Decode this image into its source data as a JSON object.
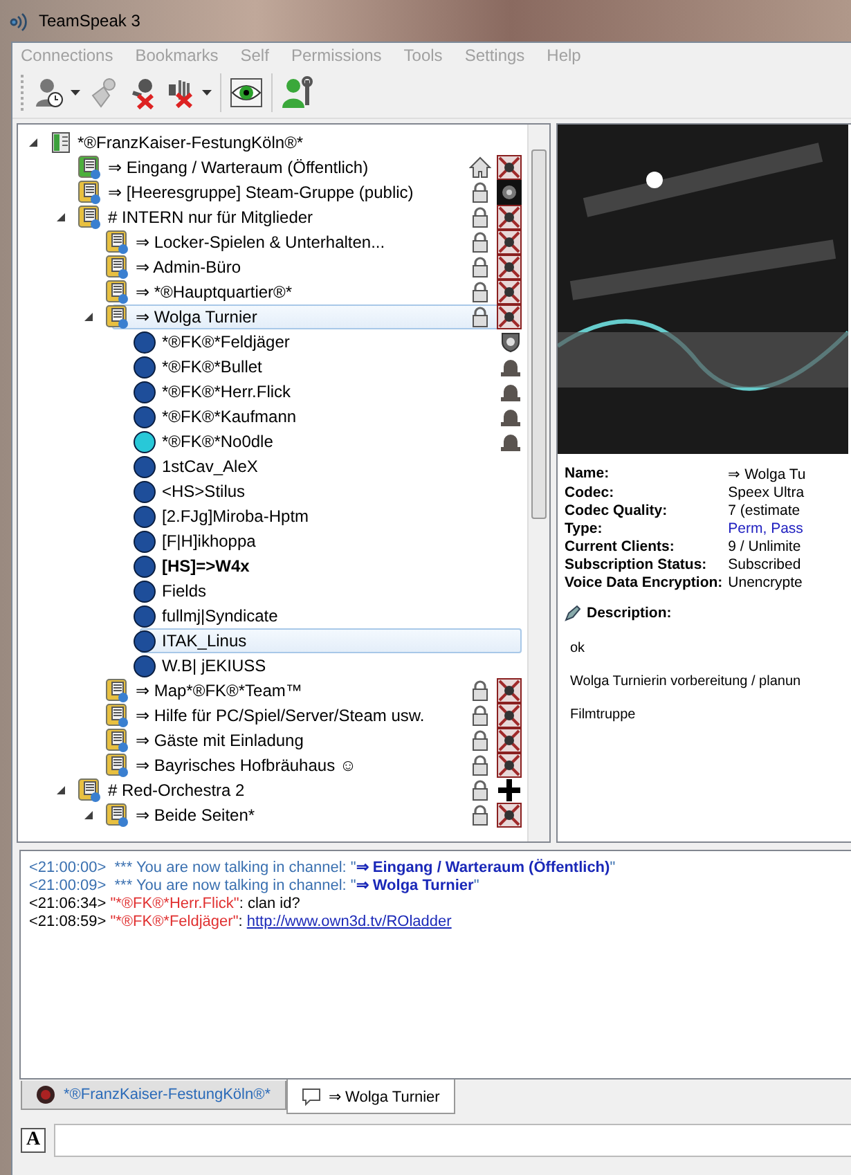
{
  "window": {
    "title": "TeamSpeak 3"
  },
  "menu": [
    "Connections",
    "Bookmarks",
    "Self",
    "Permissions",
    "Tools",
    "Settings",
    "Help"
  ],
  "tree": {
    "kind": "server",
    "name": "*®FranzKaiser-FestungKöln®*",
    "expanded": true,
    "selected": false,
    "children": [
      {
        "kind": "channel",
        "name": "⇒ Eingang / Warteraum (Öffentlich)",
        "default": true,
        "status_icon": {
          "kind": "home"
        },
        "emblem": {
          "kind": "fk"
        },
        "selected": false
      },
      {
        "kind": "channel",
        "name": "⇒ [Heeresgruppe] Steam-Gruppe (public)",
        "default": false,
        "status_icon": {
          "kind": "lock"
        },
        "emblem": {
          "kind": "steam"
        },
        "selected": false
      },
      {
        "kind": "channel",
        "name": "# INTERN nur für Mitglieder",
        "default": false,
        "status_icon": {
          "kind": "lock"
        },
        "emblem": {
          "kind": "fk"
        },
        "expanded": true,
        "selected": false,
        "children": [
          {
            "kind": "channel",
            "name": "⇒ Locker-Spielen & Unterhalten...",
            "default": false,
            "status_icon": {
              "kind": "lock"
            },
            "emblem": {
              "kind": "fk"
            },
            "selected": false
          },
          {
            "kind": "channel",
            "name": "⇒ Admin-Büro",
            "default": false,
            "status_icon": {
              "kind": "lock"
            },
            "emblem": {
              "kind": "fk"
            },
            "selected": false
          },
          {
            "kind": "channel",
            "name": "⇒ *®Hauptquartier®*",
            "default": false,
            "status_icon": {
              "kind": "lock"
            },
            "emblem": {
              "kind": "fk"
            },
            "selected": false
          },
          {
            "kind": "channel",
            "name": "⇒ Wolga Turnier",
            "default": false,
            "status_icon": {
              "kind": "lock"
            },
            "emblem": {
              "kind": "fk"
            },
            "expanded": true,
            "selected": true,
            "children": [
              {
                "kind": "client",
                "name": "*®FK®*Feldjäger",
                "talking": false,
                "bold": false,
                "emblem": {
                  "kind": "shield"
                },
                "selected": false
              },
              {
                "kind": "client",
                "name": "*®FK®*Bullet",
                "talking": false,
                "bold": false,
                "emblem": {
                  "kind": "helmet"
                },
                "selected": false
              },
              {
                "kind": "client",
                "name": "*®FK®*Herr.Flick",
                "talking": false,
                "bold": false,
                "emblem": {
                  "kind": "helmet"
                },
                "selected": false
              },
              {
                "kind": "client",
                "name": "*®FK®*Kaufmann",
                "talking": false,
                "bold": false,
                "emblem": {
                  "kind": "helmet"
                },
                "selected": false
              },
              {
                "kind": "client",
                "name": "*®FK®*No0dle",
                "talking": true,
                "bold": false,
                "emblem": {
                  "kind": "helmet"
                },
                "selected": false
              },
              {
                "kind": "client",
                "name": "1stCav_AleX",
                "talking": false,
                "bold": false,
                "selected": false
              },
              {
                "kind": "client",
                "name": "<HS>Stilus",
                "talking": false,
                "bold": false,
                "selected": false
              },
              {
                "kind": "client",
                "name": "[2.FJg]Miroba-Hptm",
                "talking": false,
                "bold": false,
                "selected": false
              },
              {
                "kind": "client",
                "name": "[F|H]ikhoppa",
                "talking": false,
                "bold": false,
                "selected": false
              },
              {
                "kind": "client",
                "name": "[HS]=>W4x",
                "talking": false,
                "bold": true,
                "selected": false
              },
              {
                "kind": "client",
                "name": "Fields",
                "talking": false,
                "bold": false,
                "selected": false
              },
              {
                "kind": "client",
                "name": "fullmj|Syndicate",
                "talking": false,
                "bold": false,
                "selected": false
              },
              {
                "kind": "client",
                "name": "ITAK_Linus",
                "talking": false,
                "bold": false,
                "selected": true
              },
              {
                "kind": "client",
                "name": "W.B| jEKIUSS",
                "talking": false,
                "bold": false,
                "selected": false
              }
            ]
          },
          {
            "kind": "channel",
            "name": "⇒ Map*®FK®*Team™",
            "default": false,
            "status_icon": {
              "kind": "lock"
            },
            "emblem": {
              "kind": "fk"
            },
            "selected": false
          },
          {
            "kind": "channel",
            "name": "⇒ Hilfe für PC/Spiel/Server/Steam usw.",
            "default": false,
            "status_icon": {
              "kind": "lock"
            },
            "emblem": {
              "kind": "fk"
            },
            "selected": false
          },
          {
            "kind": "channel",
            "name": "⇒ Gäste mit Einladung",
            "default": false,
            "status_icon": {
              "kind": "lock"
            },
            "emblem": {
              "kind": "fk"
            },
            "selected": false
          },
          {
            "kind": "channel",
            "name": "⇒ Bayrisches Hofbräuhaus ☺",
            "default": false,
            "status_icon": {
              "kind": "lock"
            },
            "emblem": {
              "kind": "fk"
            },
            "selected": false
          }
        ]
      },
      {
        "kind": "channel",
        "name": "# Red-Orchestra 2",
        "default": false,
        "status_icon": {
          "kind": "lock"
        },
        "emblem": {
          "kind": "cross"
        },
        "expanded": true,
        "selected": false,
        "children": [
          {
            "kind": "channel",
            "name": "⇒ Beide Seiten*",
            "default": false,
            "status_icon": {
              "kind": "lock"
            },
            "emblem": {
              "kind": "fk"
            },
            "expanded": true,
            "selected": false
          }
        ]
      }
    ]
  },
  "info": {
    "fields": [
      {
        "label": "Name:",
        "value": "⇒ Wolga Tu",
        "kind": "plain"
      },
      {
        "label": "Codec:",
        "value": "Speex Ultra",
        "kind": "plain"
      },
      {
        "label": "Codec Quality:",
        "value": "7 (estimate",
        "kind": "plain"
      },
      {
        "label": "Type:",
        "value": "Perm, Pass",
        "kind": "link"
      },
      {
        "label": "Current Clients:",
        "value": "9 / Unlimite",
        "kind": "plain"
      },
      {
        "label": "Subscription Status:",
        "value": "Subscribed",
        "kind": "plain"
      },
      {
        "label": "Voice Data Encryption:",
        "value": "Unencrypte",
        "kind": "plain"
      }
    ],
    "description_label": "Description:",
    "description": [
      "ok",
      "Wolga Turnierin vorbereitung / planun",
      "Filmtruppe"
    ]
  },
  "chat": [
    {
      "kind": "system",
      "time": "<21:00:00>",
      "text": "*** You are now talking in channel: \"",
      "channel": "⇒ Eingang / Warteraum (Öffentlich)",
      "end": "\""
    },
    {
      "kind": "system",
      "time": "<21:00:09>",
      "text": "*** You are now talking in channel: \"",
      "channel": "⇒ Wolga Turnier",
      "end": "\""
    },
    {
      "kind": "message",
      "time": "<21:06:34>",
      "sender": "\"*®FK®*Herr.Flick\"",
      "text": ": clan id?"
    },
    {
      "kind": "link",
      "time": "<21:08:59>",
      "sender": "\"*®FK®*Feldjäger\"",
      "text": ":",
      "link": "http://www.own3d.tv/ROladder"
    }
  ],
  "tabs": [
    {
      "label": "*®FranzKaiser-FestungKöln®*",
      "kind": "server",
      "selected": false
    },
    {
      "label": "⇒ Wolga Turnier",
      "kind": "channel",
      "selected": true
    }
  ],
  "format_button": "A"
}
